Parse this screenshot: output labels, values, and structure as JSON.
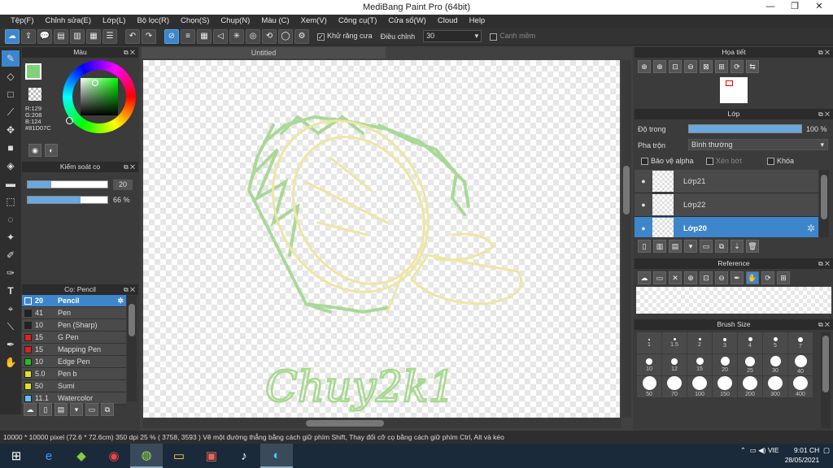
{
  "window": {
    "title": "MediBang Paint Pro (64bit)"
  },
  "menu": [
    "Tệp(F)",
    "Chỉnh sửa(E)",
    "Lớp(L)",
    "Bộ lọc(R)",
    "Chọn(S)",
    "Chụp(N)",
    "Màu (C)",
    "Xem(V)",
    "Công cụ(T)",
    "Cửa sổ(W)",
    "Cloud",
    "Help"
  ],
  "toolbar": {
    "antialias_label": "Khử răng cưa",
    "correction_label": "Điều chỉnh",
    "correction_value": "30",
    "smooth_label": "Canh mềm"
  },
  "color_panel": {
    "title": "Màu",
    "r": "R:129",
    "g": "G:208",
    "b": "B:124",
    "hex": "#81D07C",
    "fg_color": "#81D07C"
  },
  "brush_control": {
    "title": "Kiểm soát cọ",
    "size_value": "20",
    "opacity_value": "66 %",
    "size_fill": 0.3,
    "opacity_fill": 0.66
  },
  "brush_panel": {
    "title": "Cọ: Pencil",
    "items": [
      {
        "size": "20",
        "name": "Pencil",
        "color": "#3d86cc"
      },
      {
        "size": "41",
        "name": "Pen",
        "color": "#222222"
      },
      {
        "size": "10",
        "name": "Pen (Sharp)",
        "color": "#222222"
      },
      {
        "size": "15",
        "name": "G Pen",
        "color": "#e02020"
      },
      {
        "size": "15",
        "name": "Mapping Pen",
        "color": "#e02020"
      },
      {
        "size": "10",
        "name": "Edge Pen",
        "color": "#20c020"
      },
      {
        "size": "5.0",
        "name": "Pen b",
        "color": "#e0e020"
      },
      {
        "size": "50",
        "name": "Sumi",
        "color": "#e0e020"
      },
      {
        "size": "11.1",
        "name": "Watercolor",
        "color": "#60c0ff"
      }
    ]
  },
  "canvas": {
    "tab": "Untitled",
    "sketch_text": "Chuy2k1"
  },
  "navigator": {
    "title": "Họa tiết"
  },
  "layers": {
    "title": "Lớp",
    "opacity_label": "Độ trong",
    "opacity_value": "100 %",
    "blend_label": "Pha trộn",
    "blend_value": "Bình thường",
    "protect_alpha": "Bảo vệ alpha",
    "clipping": "Xén bớt",
    "lock": "Khóa",
    "items": [
      "Lớp21",
      "Lớp22",
      "Lớp20"
    ]
  },
  "reference": {
    "title": "Reference"
  },
  "brush_size": {
    "title": "Brush Size",
    "values": [
      "1",
      "1.5",
      "2",
      "3",
      "4",
      "5",
      "7",
      "10",
      "12",
      "15",
      "20",
      "25",
      "30",
      "40",
      "50",
      "70",
      "100",
      "150",
      "200",
      "300",
      "400"
    ]
  },
  "status": {
    "text": "10000 * 10000 pixel   (72.6 * 72.6cm)   350 dpi   25 %   ( 3758, 3593 )   Vẽ một đường thẳng bằng cách giữ phím Shift, Thay đổi cỡ cọ bằng cách giữ phím Ctrl, Alt và kéo"
  },
  "tray": {
    "time": "9:01 CH",
    "date": "28/05/2021",
    "lang": "VIE"
  }
}
